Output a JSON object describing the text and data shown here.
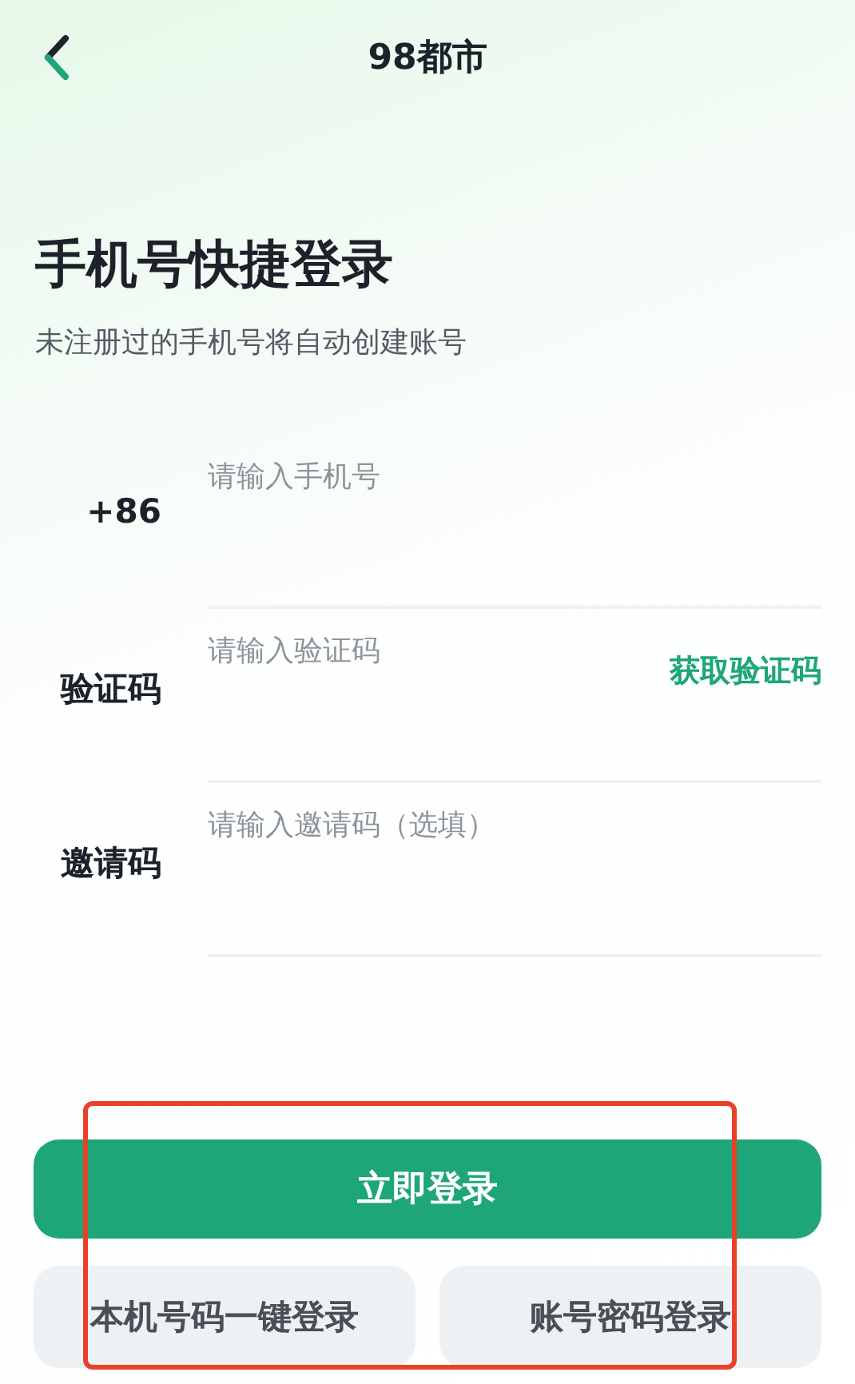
{
  "nav": {
    "title": "98都市"
  },
  "heading": {
    "title": "手机号快捷登录",
    "subtitle": "未注册过的手机号将自动创建账号"
  },
  "fields": [
    {
      "label": "+86",
      "placeholder": "请输入手机号"
    },
    {
      "label": "验证码",
      "placeholder": "请输入验证码",
      "action": "获取验证码"
    },
    {
      "label": "邀请码",
      "placeholder": "请输入邀请码（选填）"
    }
  ],
  "primary_button": "立即登录",
  "secondary_buttons": [
    "本机号码一键登录",
    "账号密码登录"
  ]
}
